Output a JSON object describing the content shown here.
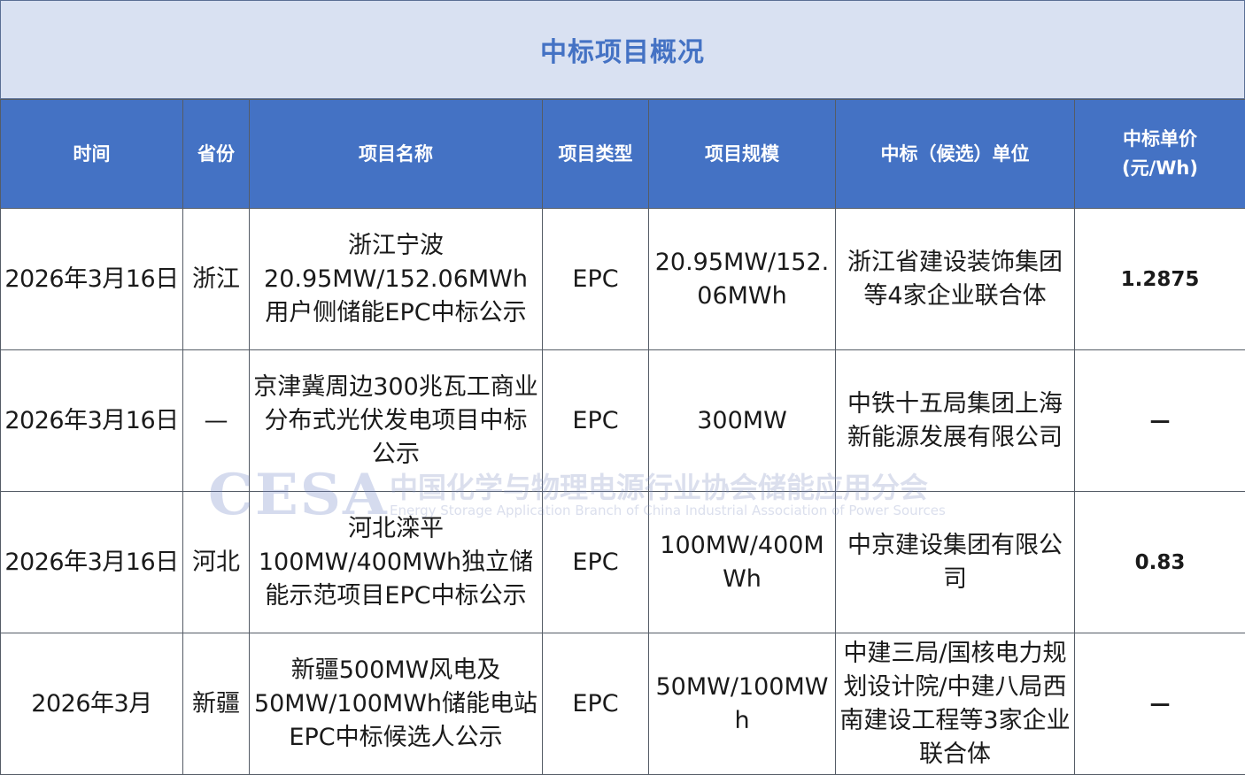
{
  "title": "中标项目概况",
  "header": {
    "time": "时间",
    "province": "省份",
    "project_name": "项目名称",
    "project_type": "项目类型",
    "project_scale": "项目规模",
    "winner": "中标（候选）单位",
    "unit_price_line1": "中标单价",
    "unit_price_line2": "(元/Wh)"
  },
  "rows": [
    {
      "time": "2026年3月16日",
      "province": "浙江",
      "project_name": "浙江宁波20.95MW/152.06MWh用户侧储能EPC中标公示",
      "project_type": "EPC",
      "project_scale": "20.95MW/152.06MWh",
      "winner": "浙江省建设装饰集团等4家企业联合体",
      "unit_price": "1.2875"
    },
    {
      "time": "2026年3月16日",
      "province": "—",
      "project_name": "京津冀周边300兆瓦工商业分布式光伏发电项目中标公示",
      "project_type": "EPC",
      "project_scale": "300MW",
      "winner": "中铁十五局集团上海新能源发展有限公司",
      "unit_price": "—"
    },
    {
      "time": "2026年3月16日",
      "province": "河北",
      "project_name": "河北滦平100MW/400MWh独立储能示范项目EPC中标公示",
      "project_type": "EPC",
      "project_scale": "100MW/400MWh",
      "winner": "中京建设集团有限公司",
      "unit_price": "0.83"
    },
    {
      "time": "2026年3月",
      "province": "新疆",
      "project_name": "新疆500MW风电及50MW/100MWh储能电站EPC中标候选人公示",
      "project_type": "EPC",
      "project_scale": "50MW/100MWh",
      "winner": "中建三局/国核电力规划设计院/中建八局西南建设工程等3家企业联合体",
      "unit_price": "—"
    }
  ],
  "watermark": {
    "logo": "CESA",
    "cn": "中国化学与物理电源行业协会储能应用分会",
    "en": "Energy Storage Application Branch of China Industrial Association of Power Sources"
  }
}
